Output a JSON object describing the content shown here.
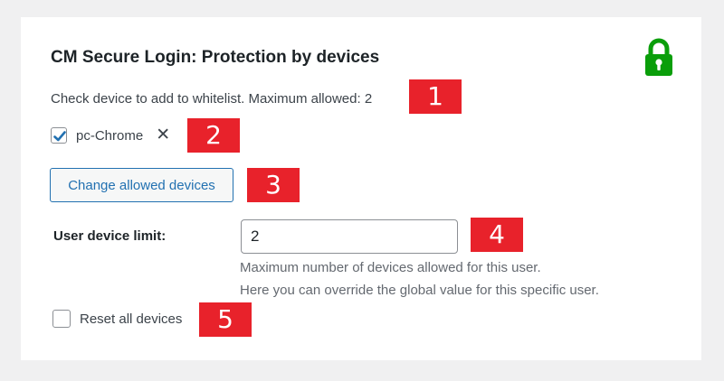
{
  "panel": {
    "title": "CM Secure Login: Protection by devices",
    "lock_icon": "lock-icon",
    "lock_color": "#0a9e0a"
  },
  "whitelist": {
    "help_text": "Check device to add to whitelist. Maximum allowed: 2",
    "devices": [
      {
        "label": "pc-Chrome",
        "checked": true,
        "remove_icon": "close-icon"
      }
    ]
  },
  "change_button": {
    "label": "Change allowed devices"
  },
  "limit": {
    "label": "User device limit:",
    "value": "2",
    "description_line1": "Maximum number of devices allowed for this user.",
    "description_line2": "Here you can override the global value for this specific user."
  },
  "reset": {
    "label": "Reset all devices",
    "checked": false
  },
  "annotations": [
    "1",
    "2",
    "3",
    "4",
    "5"
  ],
  "colors": {
    "accent": "#2271b1",
    "annotation_bg": "#e8222b",
    "page_bg": "#f0f0f1"
  }
}
